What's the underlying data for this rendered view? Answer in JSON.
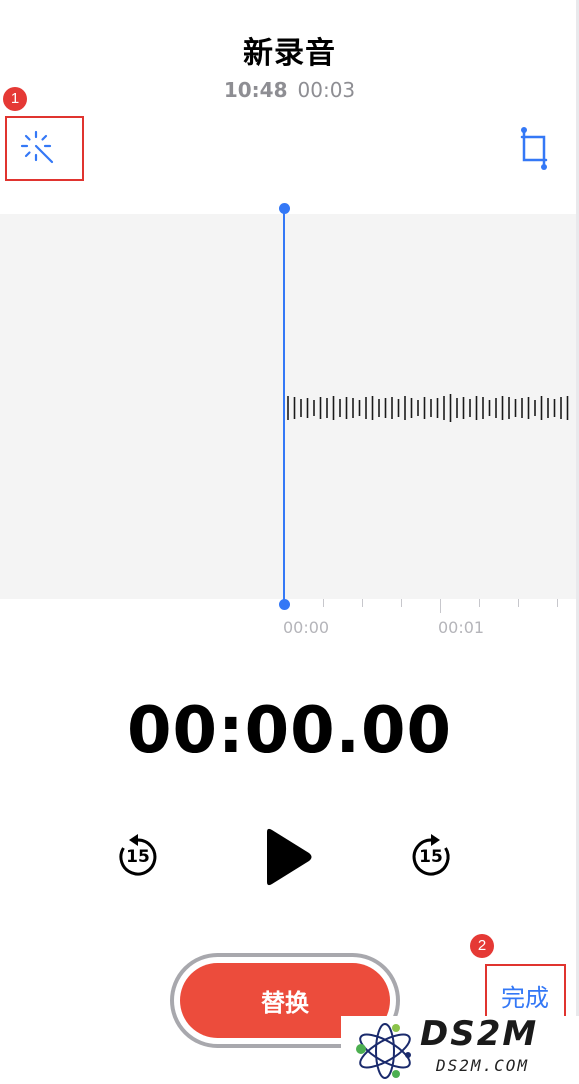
{
  "header": {
    "title": "新录音",
    "time": "10:48",
    "duration": "00:03"
  },
  "toolbar": {
    "left_icon": "magic-wand-icon",
    "right_icon": "crop-icon"
  },
  "annotations": [
    "1",
    "2"
  ],
  "timeline": {
    "labels": [
      "00:00",
      "00:01"
    ]
  },
  "player": {
    "elapsed": "00:00.00",
    "skip_back_label": "15",
    "skip_forward_label": "15",
    "play_icon": "play-icon"
  },
  "actions": {
    "replace_label": "替换",
    "done_label": "完成"
  },
  "colors": {
    "accent": "#3478f6",
    "record": "#ec4c3c",
    "annotation": "#e53935"
  },
  "watermark": {
    "brand": "DS2M",
    "domain": "DS2M.COM"
  }
}
